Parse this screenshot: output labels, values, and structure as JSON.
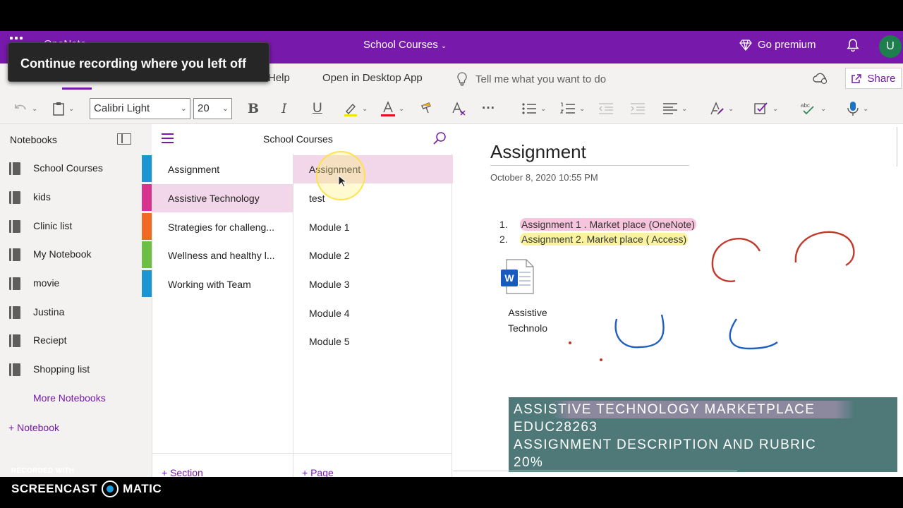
{
  "app": {
    "name": "OneNote",
    "notebook_title": "School Courses",
    "premium_label": "Go premium",
    "avatar_initial": "U",
    "brand_color": "#7719aa"
  },
  "recording": {
    "tooltip": "Continue recording where you left off",
    "watermark_small": "RECORDED WITH",
    "watermark_logo_left": "SCREENCAST",
    "watermark_logo_right": "MATIC"
  },
  "ribbon": {
    "tabs": [
      {
        "label": "Help"
      },
      {
        "label": "Open in Desktop App"
      }
    ],
    "tell_me_placeholder": "Tell me what you want to do",
    "share_label": "Share"
  },
  "toolbar": {
    "font_name": "Calibri Light",
    "font_size": "20",
    "bold": "B",
    "italic": "I",
    "underline": "U",
    "more": "···"
  },
  "notebooks_pane": {
    "header": "Notebooks",
    "items": [
      {
        "label": "School Courses"
      },
      {
        "label": "kids"
      },
      {
        "label": "Clinic list"
      },
      {
        "label": "My Notebook"
      },
      {
        "label": "movie"
      },
      {
        "label": "Justina"
      },
      {
        "label": "Reciept"
      },
      {
        "label": "Shopping list"
      }
    ],
    "more_label": "More Notebooks",
    "add_label": "Notebook"
  },
  "middle_header": {
    "title": "School Courses"
  },
  "sections": {
    "items": [
      {
        "label": "Assignment",
        "color": "#1b95d2"
      },
      {
        "label": "Assistive Technology",
        "color": "#d6338f",
        "selected": true
      },
      {
        "label": "Strategies for challeng...",
        "color": "#f06a25"
      },
      {
        "label": "Wellness and healthy l...",
        "color": "#6cbe45"
      },
      {
        "label": "Working with Team",
        "color": "#1b95d2"
      }
    ],
    "add_label": "Section"
  },
  "pages": {
    "items": [
      {
        "label": "Assignment",
        "selected": true
      },
      {
        "label": "test"
      },
      {
        "label": "Module 1"
      },
      {
        "label": "Module 2"
      },
      {
        "label": "Module 3"
      },
      {
        "label": "Module 4"
      },
      {
        "label": "Module 5"
      }
    ],
    "add_label": "Page"
  },
  "page": {
    "title": "Assignment",
    "date": "October 8, 2020",
    "time": "10:55 PM",
    "list": [
      {
        "num": "1.",
        "text": "Assignment 1 . Market place (OneNote)"
      },
      {
        "num": "2.",
        "text": "Assignment 2. Market place ( Access)"
      }
    ],
    "attachment_caption": "Assistive Technolo",
    "banner_lines": [
      "ASSISTIVE TECHNOLOGY MARKETPLACE",
      "EDUC28263",
      "ASSIGNMENT DESCRIPTION AND RUBRIC",
      "20%"
    ]
  }
}
